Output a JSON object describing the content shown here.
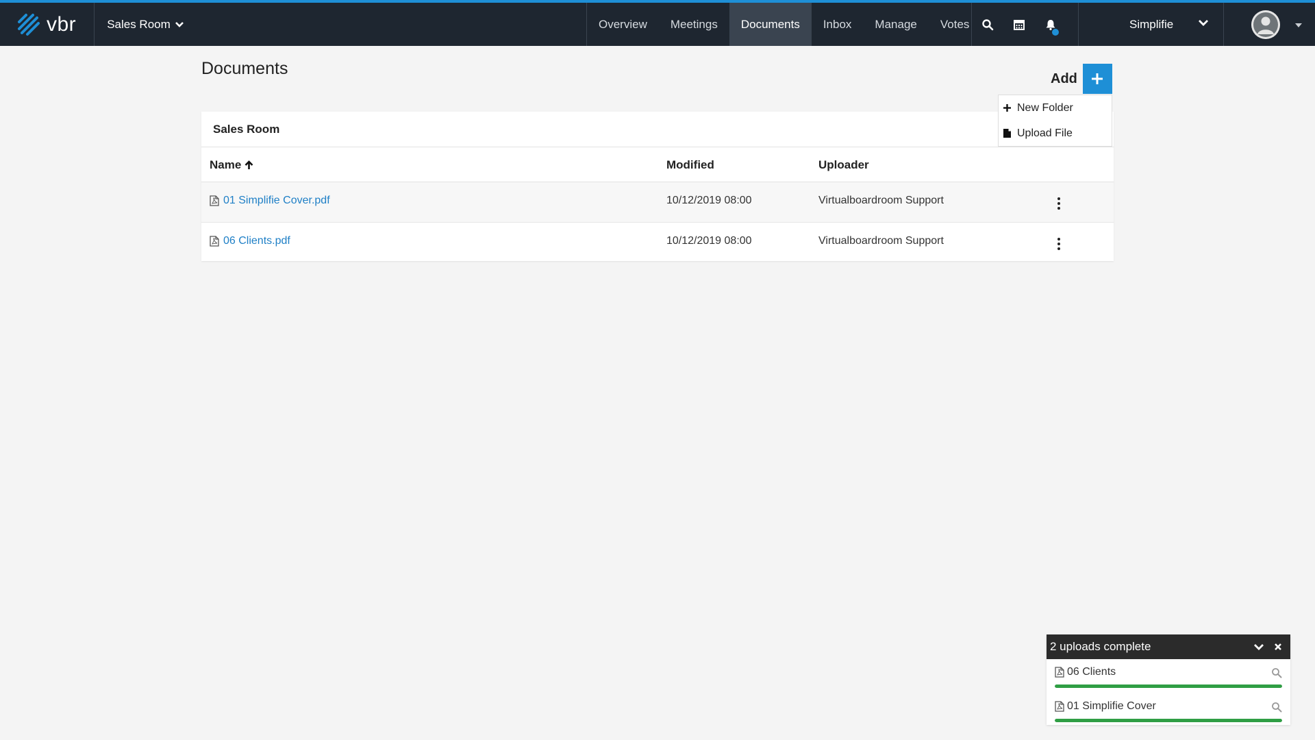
{
  "header": {
    "brand": "vbr",
    "room_selector": "Sales Room",
    "nav": [
      {
        "label": "Overview",
        "active": false
      },
      {
        "label": "Meetings",
        "active": false
      },
      {
        "label": "Documents",
        "active": true
      },
      {
        "label": "Inbox",
        "active": false
      },
      {
        "label": "Manage",
        "active": false
      },
      {
        "label": "Votes",
        "active": false
      }
    ],
    "icons": [
      "search-icon",
      "calendar-icon",
      "bell-icon"
    ],
    "org_selector": "Simplifie",
    "accent_color": "#1e8fd6"
  },
  "page": {
    "title": "Documents",
    "add_label": "Add",
    "add_menu": {
      "new_folder": "New Folder",
      "upload_file": "Upload File"
    }
  },
  "panel": {
    "heading": "Sales Room",
    "columns": {
      "name": "Name",
      "modified": "Modified",
      "uploader": "Uploader"
    },
    "rows": [
      {
        "name": "01 Simplifie Cover.pdf",
        "modified": "10/12/2019 08:00",
        "uploader": "Virtualboardroom Support"
      },
      {
        "name": "06 Clients.pdf",
        "modified": "10/12/2019 08:00",
        "uploader": "Virtualboardroom Support"
      }
    ]
  },
  "uploads": {
    "status": "2 uploads complete",
    "items": [
      {
        "name": "06 Clients",
        "progress": 1.0
      },
      {
        "name": "01 Simplifie Cover",
        "progress": 1.0
      }
    ],
    "progress_color": "#2f9e44"
  }
}
